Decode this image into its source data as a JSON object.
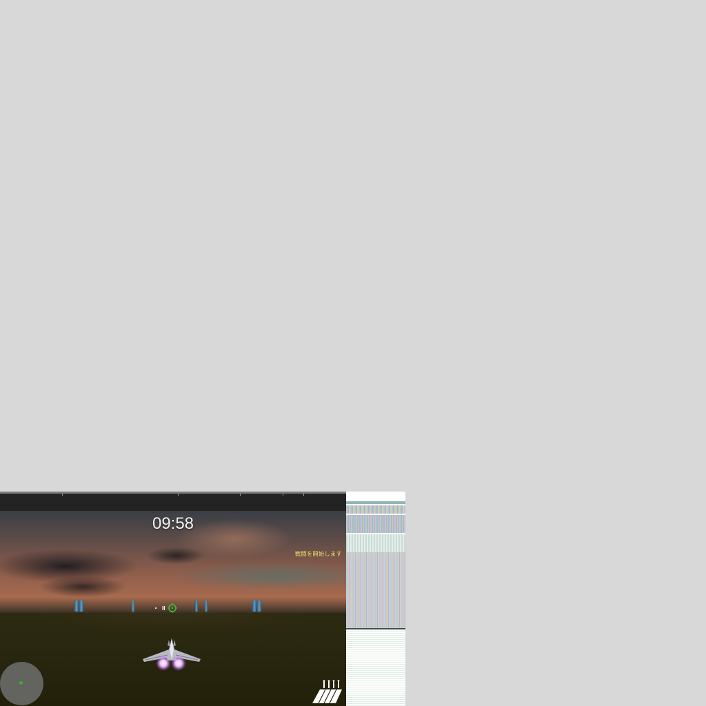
{
  "hud": {
    "timer": "09:58",
    "mission_message": "戦闘を開始します",
    "pause_symbol": "II"
  },
  "icons": {
    "crosshair": "crosshair-icon",
    "jet": "player-jet",
    "radar": "radar-minimap",
    "missiles": "missile-ammo-icon"
  },
  "colors": {
    "timer_text": "#f2f2f2",
    "mission_text": "#e9e36a",
    "crosshair": "#39c839",
    "radar_blip": "#35b335",
    "afterburner": "#e9b8ff"
  }
}
